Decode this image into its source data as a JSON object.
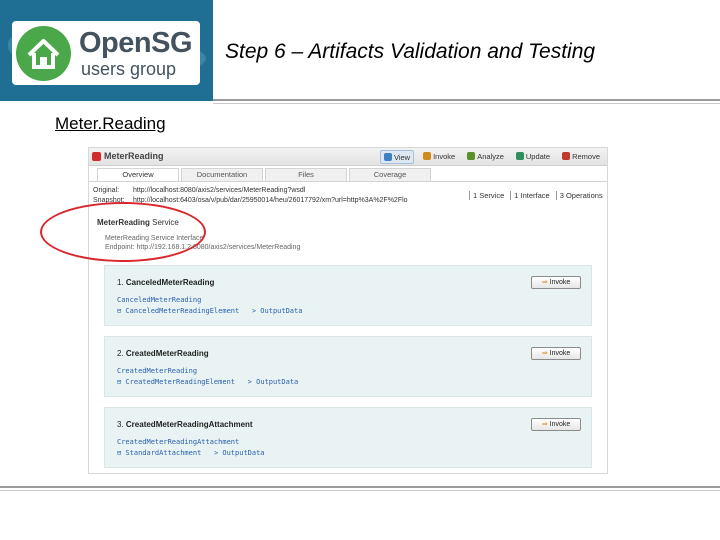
{
  "slide": {
    "title": "Step 6 – Artifacts Validation and Testing",
    "section_label": "Meter.Reading"
  },
  "logo": {
    "name": "OpenSG",
    "subtitle": "users group"
  },
  "app": {
    "title": "MeterReading",
    "toolbar": [
      {
        "label": "View",
        "icon": "view-icon",
        "color": "#3f7fc2",
        "active": true
      },
      {
        "label": "Invoke",
        "icon": "invoke-icon",
        "color": "#d08a1d",
        "active": false
      },
      {
        "label": "Analyze",
        "icon": "analyze-icon",
        "color": "#5a8f2a",
        "active": false
      },
      {
        "label": "Update",
        "icon": "update-icon",
        "color": "#2f8f5b",
        "active": false
      },
      {
        "label": "Remove",
        "icon": "remove-icon",
        "color": "#c0392b",
        "active": false
      }
    ],
    "tabs": [
      "Overview",
      "Documentation",
      "Files",
      "Coverage"
    ],
    "original_label": "Original:",
    "original_url": "http://localhost:8080/axis2/services/MeterReading?wsdl",
    "snapshot_label": "Snapshot:",
    "snapshot_url": "http://localhost:6403/osa/v/pub/dar/25950014/heu/26017792/xm?url=http%3A%2F%2Flo",
    "meta": [
      "1 Service",
      "1 Interface",
      "3 Operations"
    ],
    "service": {
      "name_bold": "MeterReading",
      "name_suffix": " Service",
      "interface": "MeterReading Service Interface",
      "endpoint": "Endpoint: http://192.168.1.2:8080/axis2/services/MeterReading"
    },
    "invoke_label": "Invoke",
    "operations": [
      {
        "number": "1.",
        "name": "CanceledMeterReading",
        "input": "CanceledMeterReading",
        "element": "⊟ CanceledMeterReadingElement",
        "output": "> OutputData"
      },
      {
        "number": "2.",
        "name": "CreatedMeterReading",
        "input": "CreatedMeterReading",
        "element": "⊟ CreatedMeterReadingElement",
        "output": "> OutputData"
      },
      {
        "number": "3.",
        "name": "CreatedMeterReadingAttachment",
        "input": "CreatedMeterReadingAttachment",
        "element": "⊟ StandardAttachment",
        "output": "> OutputData"
      }
    ]
  },
  "colors": {
    "logo_bg": "#1f6f95",
    "logo_green": "#4aa84a",
    "annotation_red": "#d9272e",
    "operation_bg": "#e9f3f3",
    "link_blue": "#2a5fb0"
  }
}
